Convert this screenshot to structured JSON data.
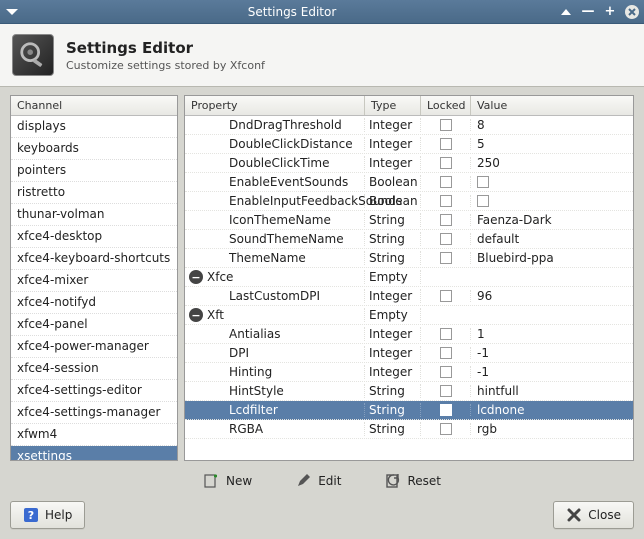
{
  "window": {
    "title": "Settings Editor",
    "controls": {
      "up": "⌃",
      "min": "—",
      "max": "+",
      "close": "✕"
    }
  },
  "header": {
    "title": "Settings Editor",
    "subtitle": "Customize settings stored by Xfconf"
  },
  "channel_header": "Channel",
  "channels": [
    "displays",
    "keyboards",
    "pointers",
    "ristretto",
    "thunar-volman",
    "xfce4-desktop",
    "xfce4-keyboard-shortcuts",
    "xfce4-mixer",
    "xfce4-notifyd",
    "xfce4-panel",
    "xfce4-power-manager",
    "xfce4-session",
    "xfce4-settings-editor",
    "xfce4-settings-manager",
    "xfwm4",
    "xsettings"
  ],
  "selected_channel": "xsettings",
  "prop_headers": {
    "property": "Property",
    "type": "Type",
    "locked": "Locked",
    "value": "Value"
  },
  "properties": [
    {
      "depth": 1,
      "name": "DndDragThreshold",
      "type": "Integer",
      "value": "8"
    },
    {
      "depth": 1,
      "name": "DoubleClickDistance",
      "type": "Integer",
      "value": "5"
    },
    {
      "depth": 1,
      "name": "DoubleClickTime",
      "type": "Integer",
      "value": "250"
    },
    {
      "depth": 1,
      "name": "EnableEventSounds",
      "type": "Boolean",
      "value_checkbox": true
    },
    {
      "depth": 1,
      "name": "EnableInputFeedbackSounds",
      "type": "Boolean",
      "value_checkbox": true
    },
    {
      "depth": 1,
      "name": "IconThemeName",
      "type": "String",
      "value": "Faenza-Dark"
    },
    {
      "depth": 1,
      "name": "SoundThemeName",
      "type": "String",
      "value": "default"
    },
    {
      "depth": 1,
      "name": "ThemeName",
      "type": "String",
      "value": "Bluebird-ppa"
    },
    {
      "depth": 0,
      "group": true,
      "name": "Xfce",
      "type": "Empty"
    },
    {
      "depth": 1,
      "name": "LastCustomDPI",
      "type": "Integer",
      "value": "96"
    },
    {
      "depth": 0,
      "group": true,
      "name": "Xft",
      "type": "Empty"
    },
    {
      "depth": 1,
      "name": "Antialias",
      "type": "Integer",
      "value": "1"
    },
    {
      "depth": 1,
      "name": "DPI",
      "type": "Integer",
      "value": "-1"
    },
    {
      "depth": 1,
      "name": "Hinting",
      "type": "Integer",
      "value": "-1"
    },
    {
      "depth": 1,
      "name": "HintStyle",
      "type": "String",
      "value": "hintfull"
    },
    {
      "depth": 1,
      "name": "Lcdfilter",
      "type": "String",
      "value": "lcdnone",
      "selected": true
    },
    {
      "depth": 1,
      "name": "RGBA",
      "type": "String",
      "value": "rgb"
    }
  ],
  "actions": {
    "new": "New",
    "edit": "Edit",
    "reset": "Reset"
  },
  "footer": {
    "help": "Help",
    "close": "Close"
  }
}
